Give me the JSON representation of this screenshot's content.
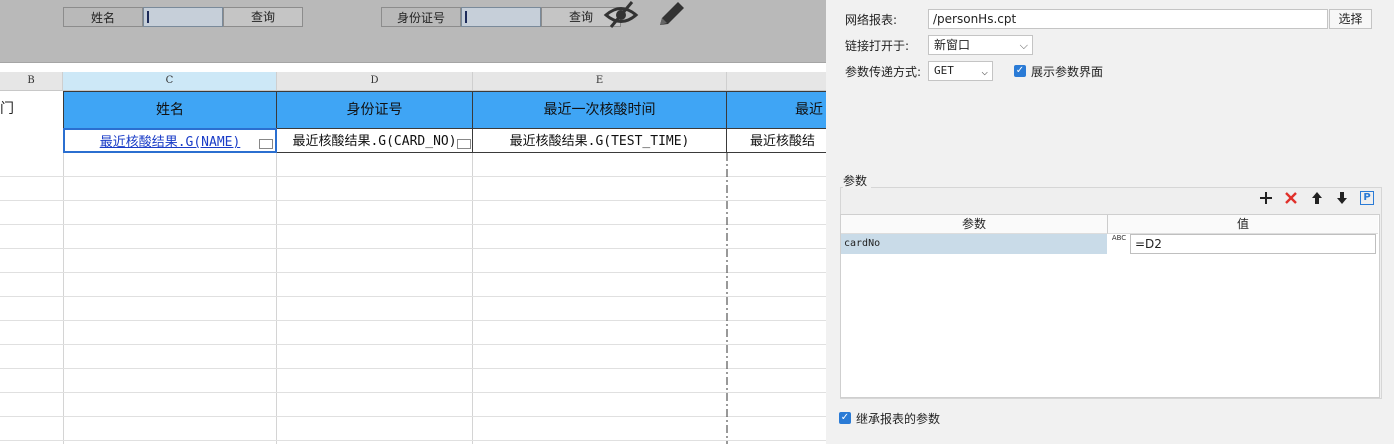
{
  "param_bar": {
    "name_label": "姓名",
    "name_query": "查询",
    "id_label": "身份证号",
    "id_query": "查询",
    "icons": [
      "eye-off-icon",
      "pencil-icon"
    ]
  },
  "columns": {
    "b": "B",
    "c": "C",
    "d": "D",
    "e": "E"
  },
  "header_row": {
    "col_b_partial": "门",
    "name": "姓名",
    "id_number": "身份证号",
    "last_test_time": "最近一次核酸时间",
    "last_partial": "最近"
  },
  "data_row": {
    "name": "最近核酸结果.G(NAME)",
    "card_no": "最近核酸结果.G(CARD_NO)",
    "test_time": "最近核酸结果.G(TEST_TIME)",
    "partial": "最近核酸结"
  },
  "panel": {
    "report_label": "网络报表:",
    "report_value": "/personHs.cpt",
    "choose_button": "选择",
    "open_label": "链接打开于:",
    "open_value": "新窗口",
    "method_label": "参数传递方式:",
    "method_value": "GET",
    "show_params_label": "展示参数界面",
    "params_title": "参数",
    "table": {
      "headers": [
        "参数",
        "值"
      ],
      "rows": [
        {
          "param": "cardNo",
          "type_icon": "ABC",
          "value": "=D2"
        }
      ]
    },
    "inherit_label": "继承报表的参数"
  },
  "colors": {
    "header_blue": "#3fa5f5",
    "link_blue": "#1a3cc7",
    "check_blue": "#2a7bd6",
    "delete_red": "#e0302a"
  }
}
